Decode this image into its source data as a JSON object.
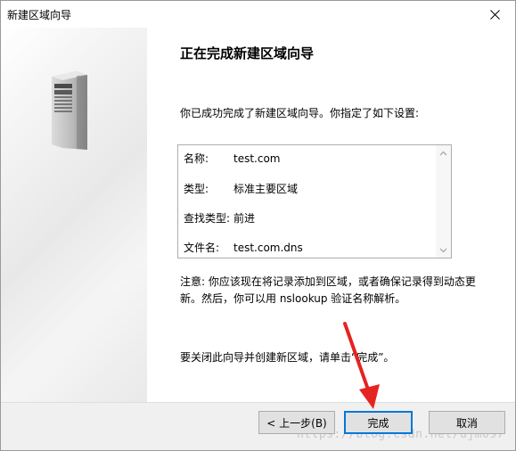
{
  "window": {
    "title": "新建区域向导"
  },
  "main": {
    "heading": "正在完成新建区域向导",
    "intro": "你已成功完成了新建区域向导。你指定了如下设置:",
    "summary": [
      {
        "label": "名称:",
        "value": "test.com"
      },
      {
        "label": "类型:",
        "value": "标准主要区域"
      },
      {
        "label": "查找类型:",
        "value": "前进"
      },
      {
        "label": "文件名:",
        "value": "test.com.dns"
      }
    ],
    "note_line1": "注意: 你应该现在将记录添加到区域，或者确保记录得到动态更",
    "note_line2": "新。然后，你可以用 nslookup 验证名称解析。",
    "closing": "要关闭此向导并创建新区域，请单击“完成”。"
  },
  "buttons": {
    "back": "< 上一步(B)",
    "finish": "完成",
    "cancel": "取消"
  },
  "watermark": "https://blog.csdn.net/ujm097",
  "colors": {
    "annotation_arrow": "#e52421",
    "focus_border": "#0078d7"
  }
}
